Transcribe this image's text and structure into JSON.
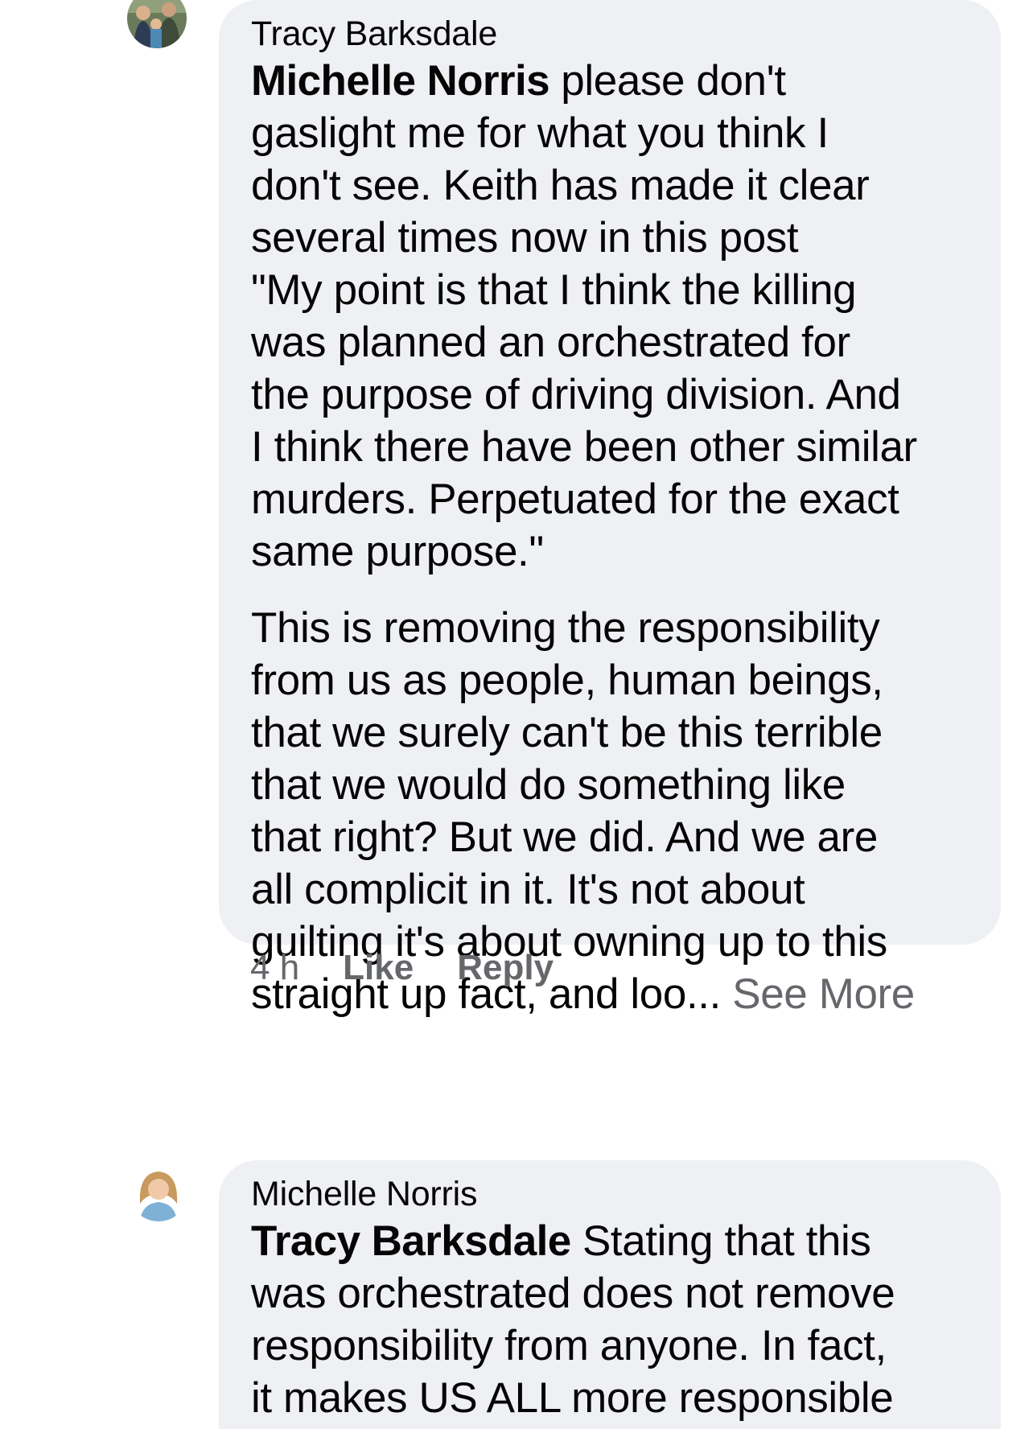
{
  "comments": [
    {
      "author": "Tracy Barksdale",
      "mention": "Michelle Norris",
      "first_line_rest": " please don't",
      "lines": [
        "gaslight me for what you think I",
        "don't see. Keith has made it clear",
        "several times now in this post",
        "\"My point is that I think the killing",
        "was planned an orchestrated for",
        "the purpose of driving division. And",
        "I think there have been other similar",
        "murders.  Perpetuated for the exact",
        "same purpose.\""
      ],
      "paragraph2_lines": [
        "This is removing the responsibility",
        "from us as people, human beings,",
        "that we surely can't be this terrible",
        "that we would do something like",
        "that right? But we did. And we are",
        "all complicit in it. It's not about",
        "guilting it's about owning up to this"
      ],
      "last_line": "straight up fact, and loo... ",
      "see_more": "See More",
      "time": "4 h",
      "like": "Like",
      "reply": "Reply"
    },
    {
      "author": "Michelle Norris",
      "mention": "Tracy Barksdale",
      "first_line_rest": " Stating that this",
      "lines": [
        "was orchestrated does not remove",
        "responsibility from anyone. In fact,",
        "it makes US ALL more responsible"
      ]
    }
  ]
}
